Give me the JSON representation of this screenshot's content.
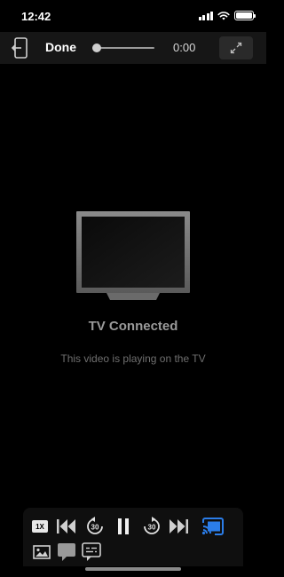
{
  "status_bar": {
    "time": "12:42"
  },
  "top_bar": {
    "done_label": "Done",
    "time": "0:00",
    "progress": 0
  },
  "center": {
    "title": "TV Connected",
    "subtitle": "This video is playing on the TV"
  },
  "controls": {
    "speed_label": "1X",
    "skip_back_seconds": "30",
    "skip_forward_seconds": "30",
    "cast_active_color": "#2b7de9"
  }
}
